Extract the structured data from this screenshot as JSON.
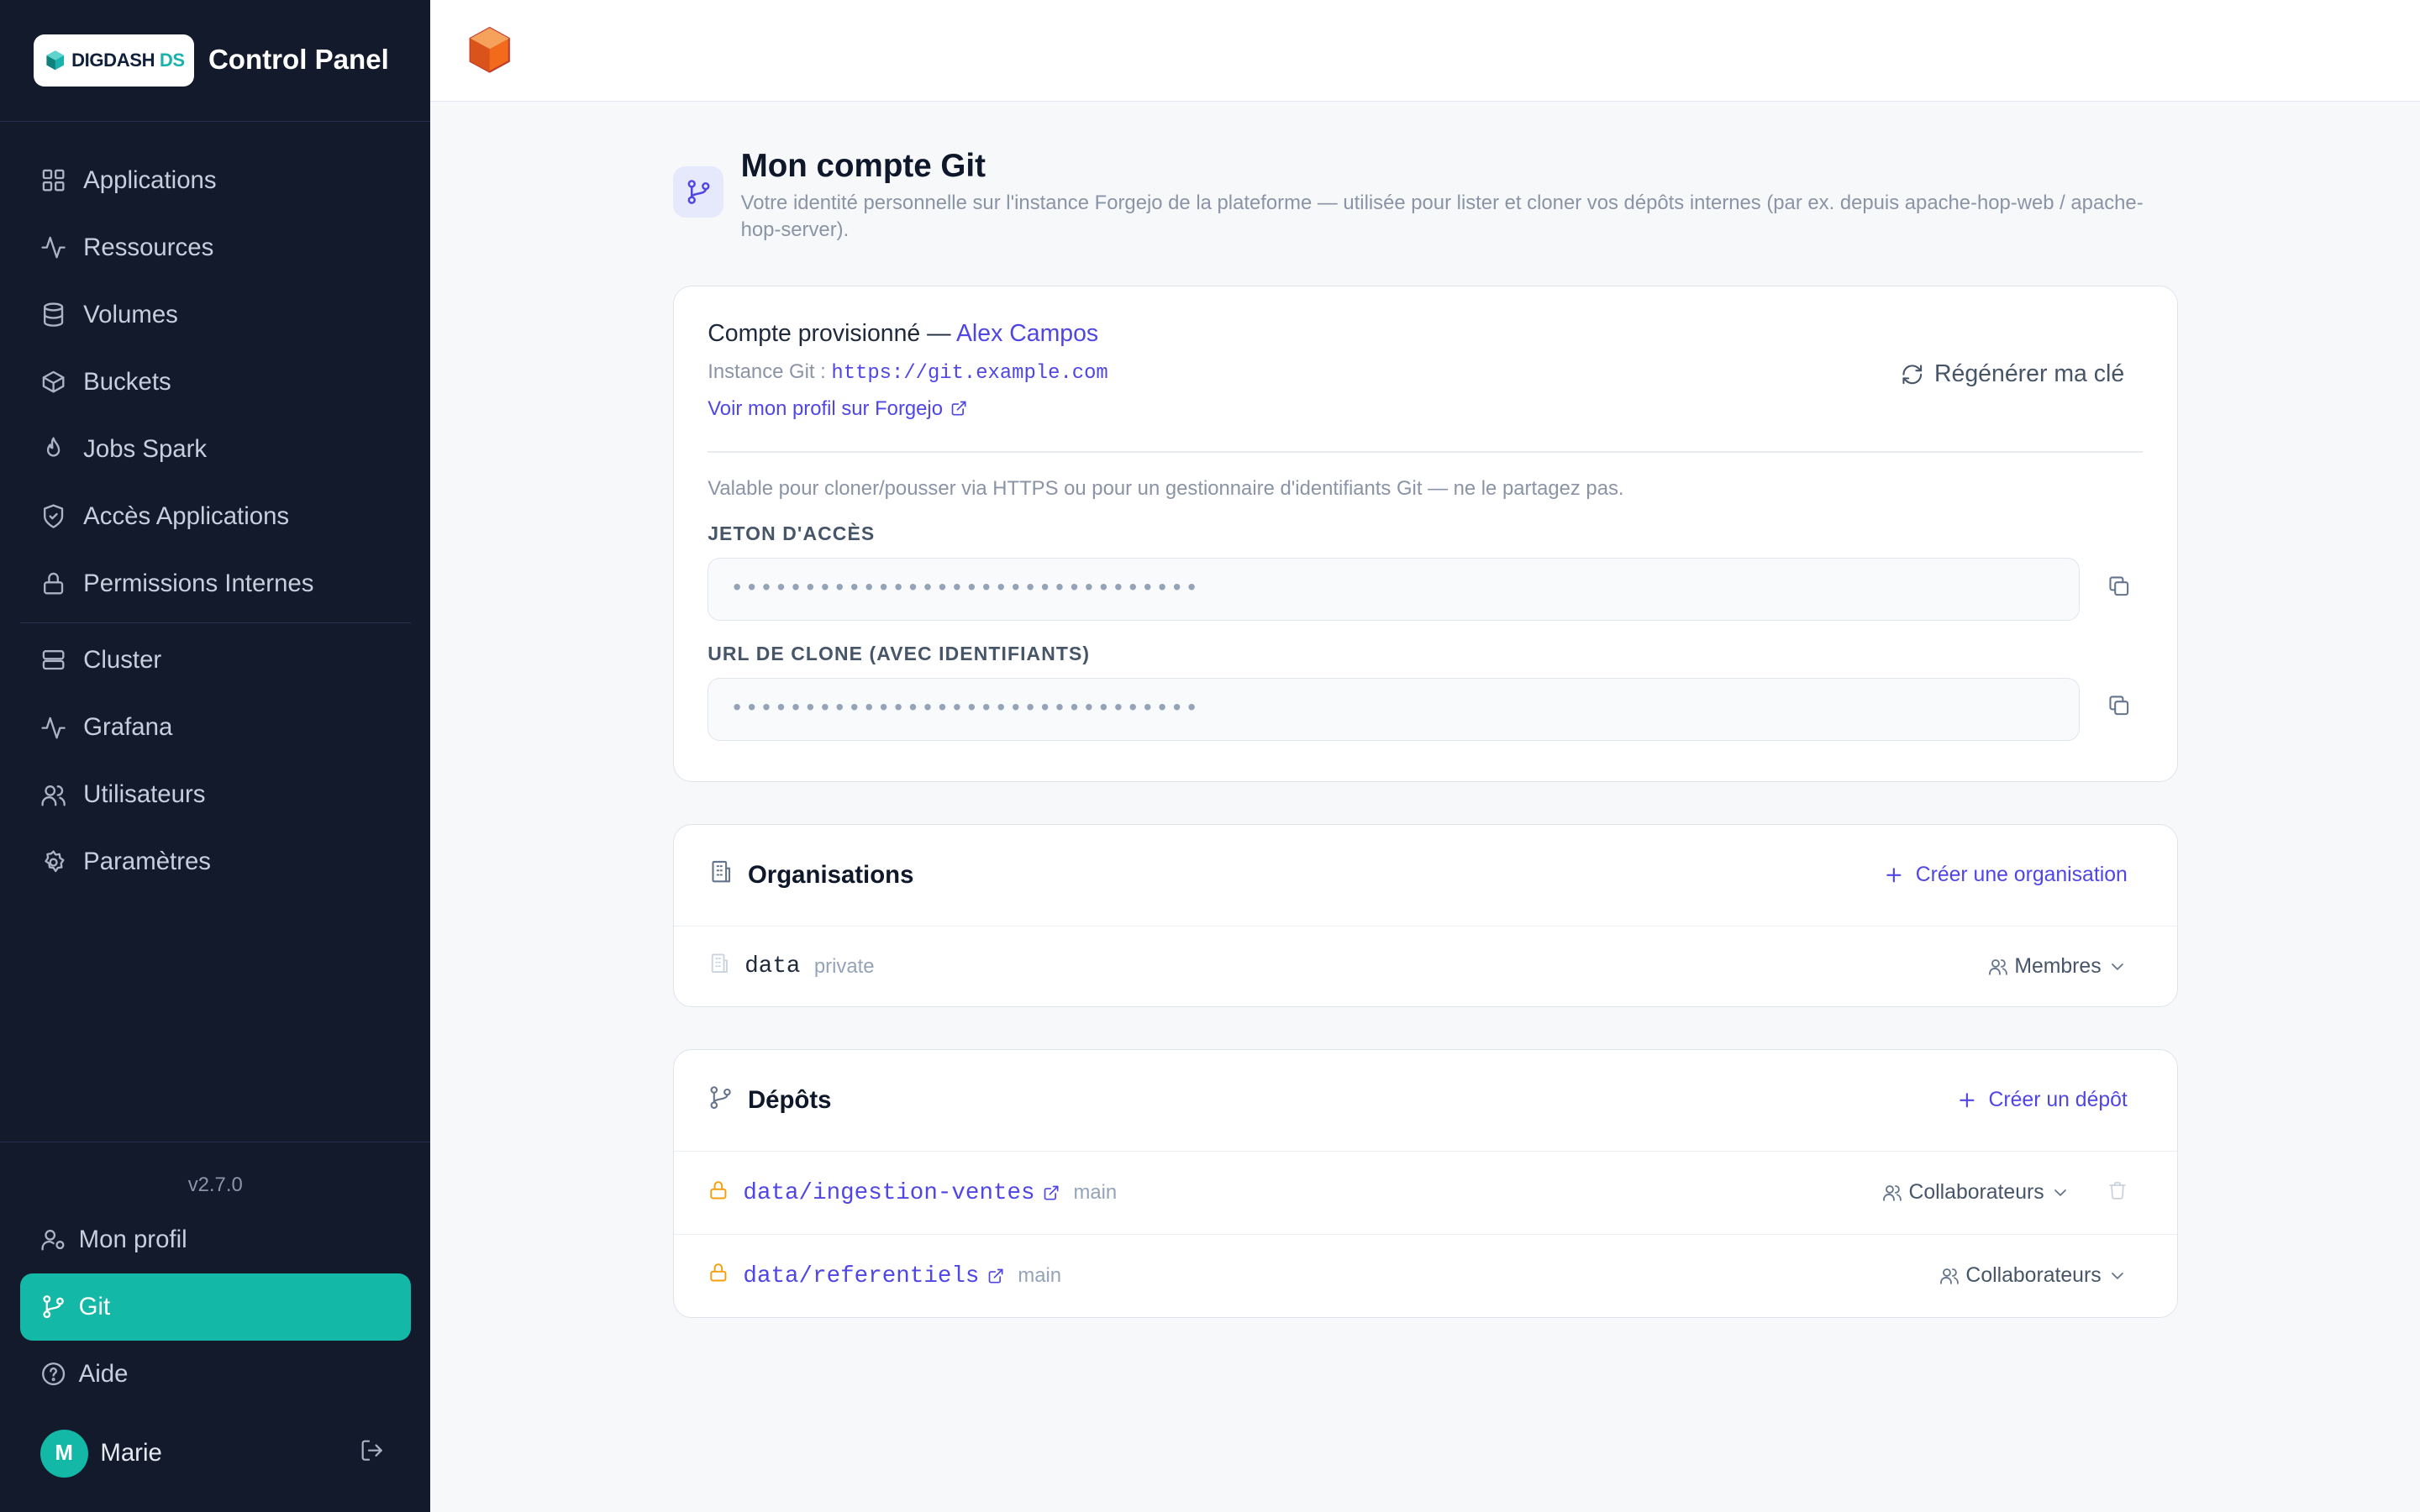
{
  "sidebar": {
    "brand": {
      "logo_main": "DIGDASH",
      "logo_suffix": "DS",
      "title": "Control Panel"
    },
    "items": [
      {
        "label": "Applications",
        "icon": "grid-icon"
      },
      {
        "label": "Ressources",
        "icon": "activity-icon"
      },
      {
        "label": "Volumes",
        "icon": "database-icon"
      },
      {
        "label": "Buckets",
        "icon": "box-icon"
      },
      {
        "label": "Jobs Spark",
        "icon": "flame-icon"
      },
      {
        "label": "Accès Applications",
        "icon": "shield-check-icon"
      },
      {
        "label": "Permissions Internes",
        "icon": "lock-icon"
      }
    ],
    "items2": [
      {
        "label": "Cluster",
        "icon": "server-icon"
      },
      {
        "label": "Grafana",
        "icon": "activity-icon"
      },
      {
        "label": "Utilisateurs",
        "icon": "users-icon"
      },
      {
        "label": "Paramètres",
        "icon": "gear-icon"
      }
    ],
    "version": "v2.7.0",
    "bottom": [
      {
        "label": "Mon profil",
        "icon": "user-cog-icon"
      },
      {
        "label": "Git",
        "icon": "git-branch-icon",
        "active": true
      },
      {
        "label": "Aide",
        "icon": "help-circle-icon"
      }
    ],
    "user": {
      "initial": "M",
      "name": "Marie"
    }
  },
  "page": {
    "title": "Mon compte Git",
    "subtitle": "Votre identité personnelle sur l'instance Forgejo de la plateforme — utilisée pour lister et cloner vos dépôts internes (par ex. depuis apache-hop-web / apache-hop-server)."
  },
  "account": {
    "prefix": "Compte provisionné — ",
    "name": "Alex Campos",
    "instance_label": "Instance Git : ",
    "instance_url": "https://git.example.com",
    "profile_link": "Voir mon profil sur Forgejo",
    "regen_label": "Régénérer ma clé",
    "hint": "Valable pour cloner/pousser via HTTPS ou pour un gestionnaire d'identifiants Git — ne le partagez pas.",
    "token_label": "Jeton d'accès",
    "token_value": "••••••••••••••••••••••••••••••••",
    "clone_label": "URL de clone (avec identifiants)",
    "clone_value": "••••••••••••••••••••••••••••••••"
  },
  "organisations": {
    "title": "Organisations",
    "create_label": "Créer une organisation",
    "items": [
      {
        "name": "data",
        "visibility": "private",
        "action": "Membres"
      }
    ]
  },
  "repos": {
    "title": "Dépôts",
    "create_label": "Créer un dépôt",
    "items": [
      {
        "name": "data/ingestion-ventes",
        "branch": "main",
        "action": "Collaborateurs",
        "deletable": true
      },
      {
        "name": "data/referentiels",
        "branch": "main",
        "action": "Collaborateurs",
        "deletable": false
      }
    ]
  },
  "colors": {
    "accent": "#4f46e5",
    "active": "#14b8a6",
    "sidebar_bg": "#121a2c",
    "lock": "#f59e0b"
  }
}
